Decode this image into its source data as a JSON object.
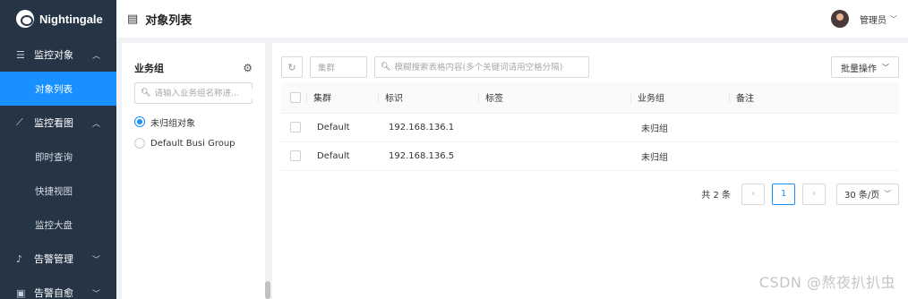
{
  "app": {
    "brand": "Nightingale"
  },
  "sidebar": {
    "groups": [
      {
        "icon": "list-icon",
        "label": "监控对象",
        "subs": [
          "对象列表"
        ]
      },
      {
        "icon": "chart-icon",
        "label": "监控看图",
        "subs": [
          "即时查询",
          "快捷视图",
          "监控大盘"
        ]
      },
      {
        "icon": "alarm-icon",
        "label": "告警管理"
      },
      {
        "icon": "self-heal-icon",
        "label": "告警自愈"
      }
    ]
  },
  "header": {
    "title": "对象列表",
    "username": "管理员"
  },
  "group_panel": {
    "title": "业务组",
    "search_placeholder": "请输入业务组名称进...",
    "options": [
      {
        "label": "未归组对象",
        "checked": true
      },
      {
        "label": "Default Busi Group",
        "checked": false
      }
    ]
  },
  "toolbar": {
    "cluster_placeholder": "集群",
    "search_placeholder": "模糊搜索表格内容(多个关键词请用空格分隔)",
    "bulk_label": "批量操作"
  },
  "table": {
    "columns": [
      "集群",
      "标识",
      "标签",
      "业务组",
      "备注"
    ],
    "rows": [
      {
        "cluster": "Default",
        "ident": "192.168.136.1",
        "tags": "",
        "group": "未归组",
        "note": ""
      },
      {
        "cluster": "Default",
        "ident": "192.168.136.5",
        "tags": "",
        "group": "未归组",
        "note": ""
      }
    ]
  },
  "pagination": {
    "total": "共 2 条",
    "current": "1",
    "page_size": "30 条/页"
  },
  "watermark": "CSDN @熬夜扒扒虫"
}
